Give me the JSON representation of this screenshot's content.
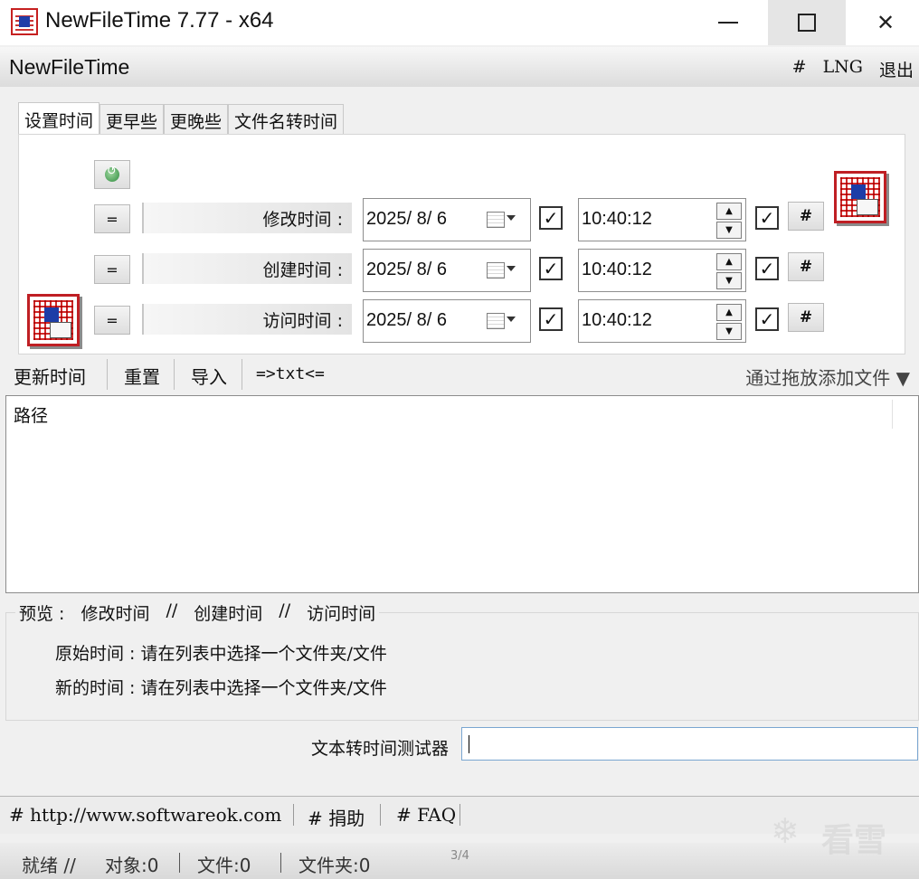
{
  "window": {
    "title": "NewFileTime 7.77 - x64",
    "minimize": "—",
    "maximize": "",
    "close": "✕"
  },
  "menubar": {
    "app_name": "NewFileTime",
    "items": [
      "#",
      "LNG",
      "退出"
    ]
  },
  "tabs": [
    {
      "label": "设置时间",
      "active": true
    },
    {
      "label": "更早些",
      "active": false
    },
    {
      "label": "更晚些",
      "active": false
    },
    {
      "label": "文件名转时间",
      "active": false
    }
  ],
  "time_rows": [
    {
      "equals": "=",
      "label": "修改时间 :",
      "date": "2025/  8/  6",
      "date_checked": "✓",
      "time": "10:40:12",
      "time_checked": "✓",
      "hash": "#"
    },
    {
      "equals": "=",
      "label": "创建时间 :",
      "date": "2025/  8/  6",
      "date_checked": "✓",
      "time": "10:40:12",
      "time_checked": "✓",
      "hash": "#"
    },
    {
      "equals": "=",
      "label": "访问时间 :",
      "date": "2025/  8/  6",
      "date_checked": "✓",
      "time": "10:40:12",
      "time_checked": "✓",
      "hash": "#"
    }
  ],
  "toolbar": {
    "update": "更新时间",
    "reset": "重置",
    "import": "导入",
    "txt": "=>txt<=",
    "drop": "通过拖放添加文件 ▼"
  },
  "list": {
    "column": "路径"
  },
  "preview": {
    "legend": [
      "预览 :",
      "修改时间",
      "//",
      "创建时间",
      "//",
      "访问时间"
    ],
    "original": "原始时间 : 请在列表中选择一个文件夹/文件",
    "new": "新的时间 : 请在列表中选择一个文件夹/文件"
  },
  "tester": {
    "label": "文本转时间测试器",
    "value": ""
  },
  "footer": {
    "links": [
      "# http://www.softwareok.com",
      "# 捐助",
      "# FAQ"
    ]
  },
  "status": {
    "ready": "就绪 //",
    "objects": "对象:0",
    "files": "文件:0",
    "folders": "文件夹:0"
  },
  "watermark": "看雪",
  "page_indicator": "3/4"
}
